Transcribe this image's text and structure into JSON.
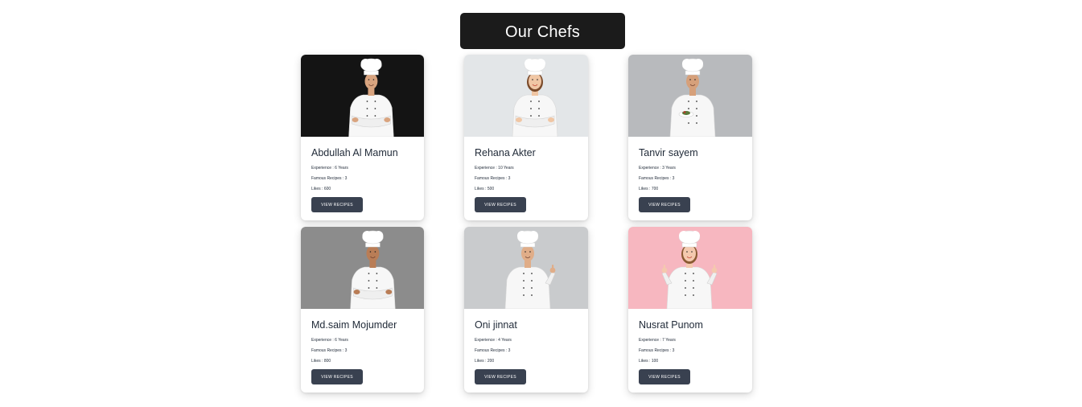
{
  "header": {
    "title": "Our Chefs"
  },
  "chefs": [
    {
      "name": "Abdullah Al Mamun",
      "experience": "Experience : 6 Years",
      "recipes": "Famous Recipes : 3",
      "likes": "Likes : 600",
      "button": "VIEW RECIPES",
      "photo_bg": "#141414",
      "photo": "chef-male-crossed-arms"
    },
    {
      "name": "Rehana Akter",
      "experience": "Experience : 10 Years",
      "recipes": "Famous Recipes : 3",
      "likes": "Likes : 500",
      "button": "VIEW RECIPES",
      "photo_bg": "#e3e6e8",
      "photo": "chef-female-crossed-arms"
    },
    {
      "name": "Tanvir sayem",
      "experience": "Experience : 3 Years",
      "recipes": "Famous Recipes : 3",
      "likes": "Likes : 700",
      "button": "VIEW RECIPES",
      "photo_bg": "#b8babd",
      "photo": "chef-male-holding-plate"
    },
    {
      "name": "Md.saim Mojumder",
      "experience": "Experience : 6 Years",
      "recipes": "Famous Recipes : 3",
      "likes": "Likes : 800",
      "button": "VIEW RECIPES",
      "photo_bg": "#8c8c8c",
      "photo": "chef-male-crossed-arms"
    },
    {
      "name": "Oni jinnat",
      "experience": "Experience : 4 Years",
      "recipes": "Famous Recipes : 3",
      "likes": "Likes : 200",
      "button": "VIEW RECIPES",
      "photo_bg": "#c9cbcd",
      "photo": "chef-male-thumbs-up"
    },
    {
      "name": "Nusrat Punom",
      "experience": "Experience : 7 Years",
      "recipes": "Famous Recipes : 3",
      "likes": "Likes : 100",
      "button": "VIEW RECIPES",
      "photo_bg": "#f7b7c0",
      "photo": "chef-female-thumbs-up"
    }
  ],
  "colors": {
    "title_bg": "#1b1b1b",
    "button_bg": "#394150",
    "text": "#1f2937"
  }
}
